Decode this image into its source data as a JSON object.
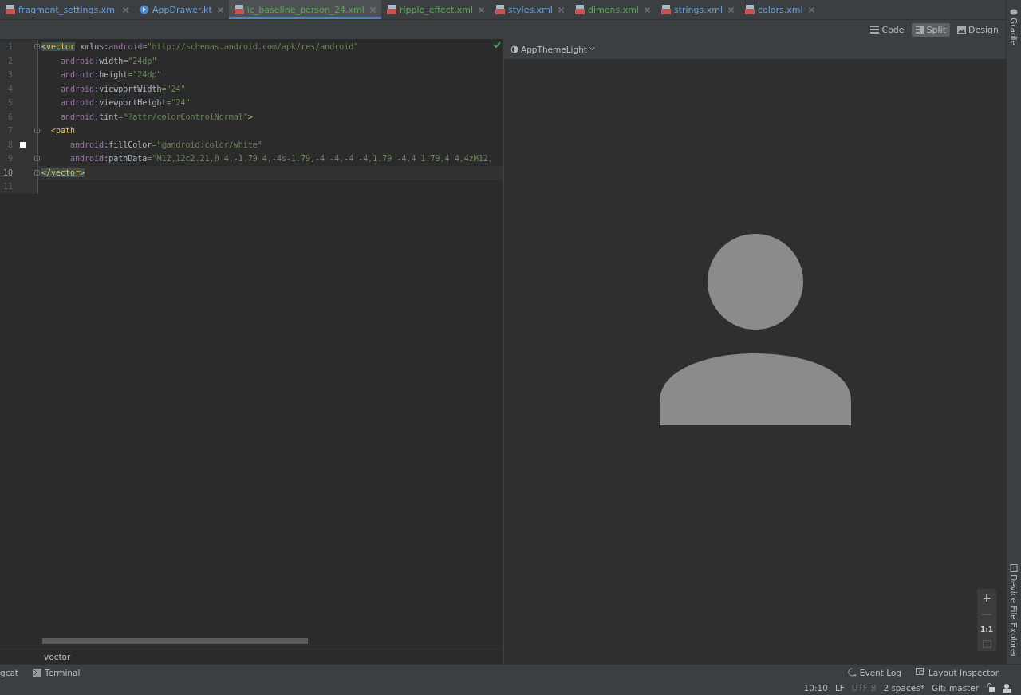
{
  "tabs": [
    {
      "label": "fragment_settings.xml",
      "kind": "xml",
      "color": "#6f9fd8",
      "selected": false
    },
    {
      "label": "AppDrawer.kt",
      "kind": "kotlin",
      "color": "#6f9fd8",
      "selected": false
    },
    {
      "label": "ic_baseline_person_24.xml",
      "kind": "xml",
      "color": "#62a35c",
      "selected": true
    },
    {
      "label": "ripple_effect.xml",
      "kind": "xml",
      "color": "#62a35c",
      "selected": false
    },
    {
      "label": "styles.xml",
      "kind": "xml",
      "color": "#6f9fd8",
      "selected": false
    },
    {
      "label": "dimens.xml",
      "kind": "xml",
      "color": "#62a35c",
      "selected": false
    },
    {
      "label": "strings.xml",
      "kind": "xml",
      "color": "#6f9fd8",
      "selected": false
    },
    {
      "label": "colors.xml",
      "kind": "xml",
      "color": "#6f9fd8",
      "selected": false
    }
  ],
  "view_modes": [
    {
      "label": "Code",
      "kind": "code",
      "selected": false
    },
    {
      "label": "Split",
      "kind": "split",
      "selected": true
    },
    {
      "label": "Design",
      "kind": "design",
      "selected": false
    }
  ],
  "editor": {
    "lines": [
      {
        "number": "1",
        "kind": "root_tag",
        "fold": true,
        "swatch": false,
        "current": false,
        "tokens": [
          {
            "kind": "tag",
            "text": "<vector",
            "match": true
          },
          {
            "kind": "plain",
            "text": " xmlns:"
          },
          {
            "kind": "ns",
            "text": "android"
          },
          {
            "kind": "value",
            "text": "=\"http://schemas.android.com/apk/res/android\""
          }
        ]
      },
      {
        "number": "2",
        "kind": "root_attribute",
        "fold": false,
        "swatch": false,
        "current": false,
        "tokens": [
          {
            "kind": "ns",
            "text": "android"
          },
          {
            "kind": "plain",
            "text": ":width"
          },
          {
            "kind": "value",
            "text": "=\"24dp\""
          }
        ]
      },
      {
        "number": "3",
        "kind": "root_attribute",
        "fold": false,
        "swatch": false,
        "current": false,
        "tokens": [
          {
            "kind": "ns",
            "text": "android"
          },
          {
            "kind": "plain",
            "text": ":height"
          },
          {
            "kind": "value",
            "text": "=\"24dp\""
          }
        ]
      },
      {
        "number": "4",
        "kind": "root_attribute",
        "fold": false,
        "swatch": false,
        "current": false,
        "tokens": [
          {
            "kind": "ns",
            "text": "android"
          },
          {
            "kind": "plain",
            "text": ":viewportWidth"
          },
          {
            "kind": "value",
            "text": "=\"24\""
          }
        ]
      },
      {
        "number": "5",
        "kind": "root_attribute",
        "fold": false,
        "swatch": false,
        "current": false,
        "tokens": [
          {
            "kind": "ns",
            "text": "android"
          },
          {
            "kind": "plain",
            "text": ":viewportHeight"
          },
          {
            "kind": "value",
            "text": "=\"24\""
          }
        ]
      },
      {
        "number": "6",
        "kind": "root_attribute",
        "fold": false,
        "swatch": false,
        "current": false,
        "tokens": [
          {
            "kind": "ns",
            "text": "android"
          },
          {
            "kind": "plain",
            "text": ":tint"
          },
          {
            "kind": "value",
            "text": "=\"?attr/colorControlNormal\""
          },
          {
            "kind": "tag",
            "text": ">",
            "match": false
          }
        ]
      },
      {
        "number": "7",
        "kind": "child_tag",
        "fold": true,
        "swatch": false,
        "current": false,
        "tokens": [
          {
            "kind": "tag",
            "text": "<path",
            "match": false
          }
        ]
      },
      {
        "number": "8",
        "kind": "child_attribute",
        "fold": false,
        "swatch": true,
        "current": false,
        "tokens": [
          {
            "kind": "ns",
            "text": "android"
          },
          {
            "kind": "plain",
            "text": ":fillColor"
          },
          {
            "kind": "value",
            "text": "=\"@android:color/white\""
          }
        ]
      },
      {
        "number": "9",
        "kind": "child_attribute",
        "fold": true,
        "swatch": false,
        "current": false,
        "tokens": [
          {
            "kind": "ns",
            "text": "android"
          },
          {
            "kind": "plain",
            "text": ":pathData"
          },
          {
            "kind": "value",
            "text": "=\"M12,12c2.21,0 4,-1.79 4,-4s-1.79,-4 -4,-4 -4,1.79 -4,4 1.79,4 4,4zM12,"
          }
        ]
      },
      {
        "number": "10",
        "kind": "root_tag",
        "fold": true,
        "swatch": false,
        "current": true,
        "tokens": [
          {
            "kind": "tag",
            "text": "</vector>",
            "match": true
          }
        ]
      },
      {
        "number": "11",
        "fold": false,
        "swatch": false,
        "current": false
      }
    ],
    "breadcrumb": "vector"
  },
  "preview": {
    "theme": "AppThemeLight",
    "zoom": [
      {
        "label": "+",
        "disabled": false
      },
      {
        "label": "—",
        "disabled": true
      },
      {
        "label": "1:1",
        "disabled": false
      }
    ]
  },
  "side_tools": {
    "top": "Gradle",
    "bottom": "Device File Explorer"
  },
  "tool_windows": {
    "left": [
      {
        "label": "gcat",
        "kind": "logcat"
      },
      {
        "label": "Terminal",
        "kind": "terminal"
      }
    ],
    "right": [
      {
        "label": "Event Log",
        "kind": "event"
      },
      {
        "label": "Layout Inspector",
        "kind": "inspector"
      }
    ]
  },
  "status_bar": [
    {
      "label": "10:10",
      "disabled": false
    },
    {
      "label": "LF",
      "disabled": false
    },
    {
      "label": "UTF-8",
      "disabled": true
    },
    {
      "label": "2 spaces*",
      "disabled": false
    },
    {
      "label": "Git: master",
      "disabled": false
    }
  ]
}
